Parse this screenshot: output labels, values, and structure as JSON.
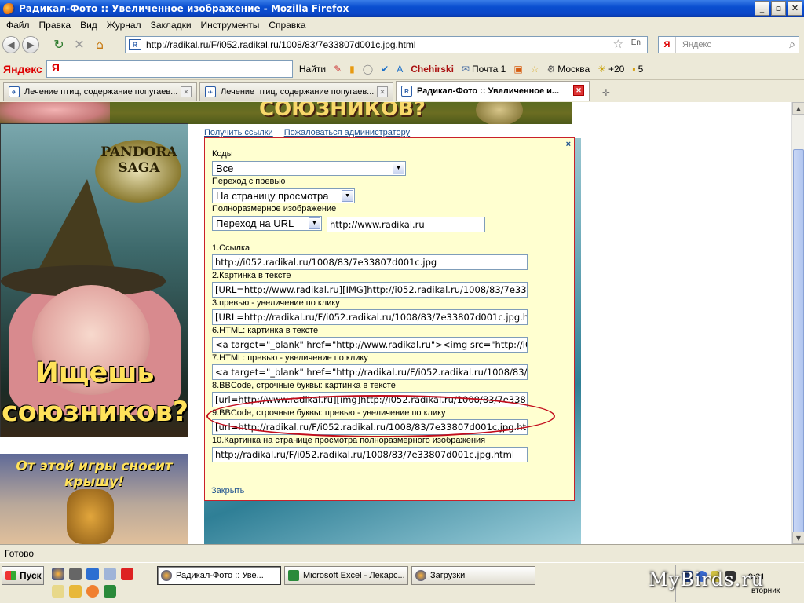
{
  "window": {
    "title": "Радикал-Фото :: Увеличенное изображение - Mozilla Firefox",
    "min": "_",
    "max": "▫",
    "close": "✕"
  },
  "menu": [
    "Файл",
    "Правка",
    "Вид",
    "Журнал",
    "Закладки",
    "Инструменты",
    "Справка"
  ],
  "nav": {
    "url": "http://radikal.ru/F/i052.radikal.ru/1008/83/7e33807d001c.jpg.html",
    "lang": "En",
    "search_placeholder": "Яндекс"
  },
  "yandex_bar": {
    "logo": "Яндекс",
    "input_text": "Я",
    "find": "Найти",
    "user": "Chehirski",
    "mail": "Почта 1",
    "city": "Москва",
    "temp": "+20",
    "count": "5"
  },
  "tabs": [
    {
      "label": "Лечение птиц, содержание попугаев..."
    },
    {
      "label": "Лечение птиц, содержание попугаев..."
    },
    {
      "label": "Радикал-Фото :: Увеличенное и..."
    }
  ],
  "page": {
    "banner_top_text": "СОЮЗНИКОВ?",
    "ad_logo": "PANDORA SAGA",
    "ad_slogan": "Ищешь союзников?",
    "ad2_text": "От этой игры сносит крышу!",
    "link_get": "Получить ссылки",
    "link_complain": "Пожаловаться администратору",
    "dialog": {
      "close_x": "×",
      "codes_label": "Коды",
      "codes_value": "Все",
      "preview_label": "Переход с превью",
      "preview_value": "На страницу просмотра",
      "full_label": "Полноразмерное изображение",
      "full_value": "Переход на URL",
      "full_url": "http://www.radikal.ru",
      "fields": [
        {
          "label": "1.Ссылка",
          "value": "http://i052.radikal.ru/1008/83/7e33807d001c.jpg"
        },
        {
          "label": "2.Картинка в тексте",
          "value": "[URL=http://www.radikal.ru][IMG]http://i052.radikal.ru/1008/83/7e33"
        },
        {
          "label": "3.превью - увеличение по клику",
          "value": "[URL=http://radikal.ru/F/i052.radikal.ru/1008/83/7e33807d001c.jpg.h"
        },
        {
          "label": "6.HTML: картинка в тексте",
          "value": "<a target=\"_blank\" href=\"http://www.radikal.ru\"><img src=\"http://i0"
        },
        {
          "label": "7.HTML: превью - увеличение по клику",
          "value": "<a target=\"_blank\" href=\"http://radikal.ru/F/i052.radikal.ru/1008/83/"
        },
        {
          "label": "8.BBCode, строчные буквы: картинка в тексте",
          "value": "[url=http://www.radikal.ru][img]http://i052.radikal.ru/1008/83/7e338"
        },
        {
          "label": "9.BBCode, строчные буквы: превью - увеличение по клику",
          "value": "[url=http://radikal.ru/F/i052.radikal.ru/1008/83/7e33807d001c.jpg.ht"
        },
        {
          "label": "10.Картинка на странице просмотра полноразмерного изображения",
          "value": "http://radikal.ru/F/i052.radikal.ru/1008/83/7e33807d001c.jpg.html"
        }
      ],
      "close_link": "Закрыть"
    }
  },
  "status": "Готово",
  "taskbar": {
    "start": "Пуск",
    "tasks": [
      {
        "label": "Радикал-Фото :: Уве..."
      },
      {
        "label": "Microsoft Excel - Лекарс..."
      },
      {
        "label": "Загрузки"
      }
    ],
    "clock": "9:31",
    "day": "вторник"
  },
  "watermark": "MyBirds.ru",
  "colors": {
    "accent": "#0a4fd0",
    "dialog_bg": "#ffffd0",
    "dialog_border": "#c9202a",
    "link": "#1b4f8e",
    "highlight": "#c20d1c"
  }
}
